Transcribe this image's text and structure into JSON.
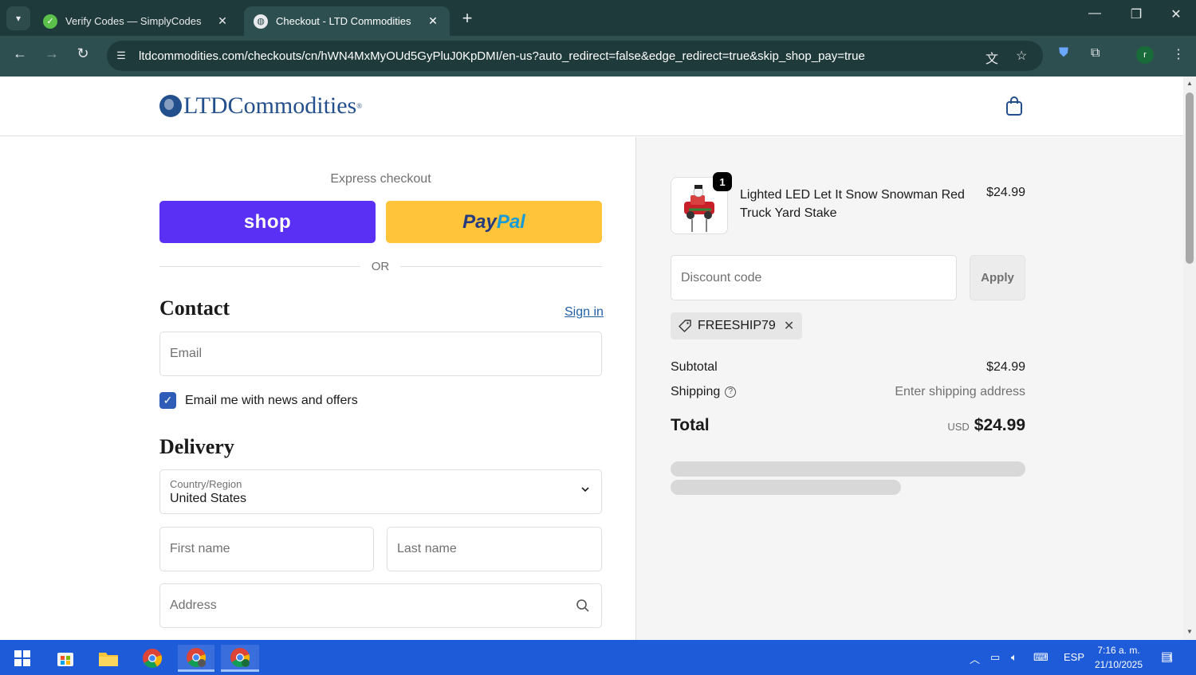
{
  "browser": {
    "tabs": [
      {
        "title": "Verify Codes — SimplyCodes",
        "active": false
      },
      {
        "title": "Checkout - LTD Commodities",
        "active": true
      }
    ],
    "url": "ltdcommodities.com/checkouts/cn/hWN4MxMyOUd5GyPluJ0KpDMI/en-us?auto_redirect=false&edge_redirect=true&skip_shop_pay=true",
    "profile_initial": "r"
  },
  "header": {
    "logo_text": "LTDCommodities",
    "logo_mark": "®"
  },
  "checkout": {
    "express_label": "Express checkout",
    "shop_label": "shop",
    "paypal_part1": "Pay",
    "paypal_part2": "Pal",
    "or_label": "OR",
    "contact_title": "Contact",
    "sign_in": "Sign in",
    "email_placeholder": "Email",
    "news_label": "Email me with news and offers",
    "delivery_title": "Delivery",
    "country_label": "Country/Region",
    "country_value": "United States",
    "first_name_placeholder": "First name",
    "last_name_placeholder": "Last name",
    "address_placeholder": "Address"
  },
  "summary": {
    "item": {
      "name": "Lighted LED Let It Snow Snowman Red Truck Yard Stake",
      "price": "$24.99",
      "quantity": "1"
    },
    "discount_placeholder": "Discount code",
    "apply_label": "Apply",
    "applied_code": "FREESHIP79",
    "subtotal_label": "Subtotal",
    "subtotal_value": "$24.99",
    "shipping_label": "Shipping",
    "shipping_value": "Enter shipping address",
    "total_label": "Total",
    "total_currency": "USD",
    "total_value": "$24.99"
  },
  "taskbar": {
    "language": "ESP",
    "time": "7:16 a. m.",
    "date": "21/10/2025",
    "notifications": "1"
  },
  "colors": {
    "chrome_dark": "#1f3a3a",
    "chrome_toolbar": "#2e4f4f",
    "shop_purple": "#5a31f4",
    "paypal_yellow": "#ffc439",
    "link_blue": "#1f5fa8",
    "taskbar_blue": "#1e5bd8"
  }
}
